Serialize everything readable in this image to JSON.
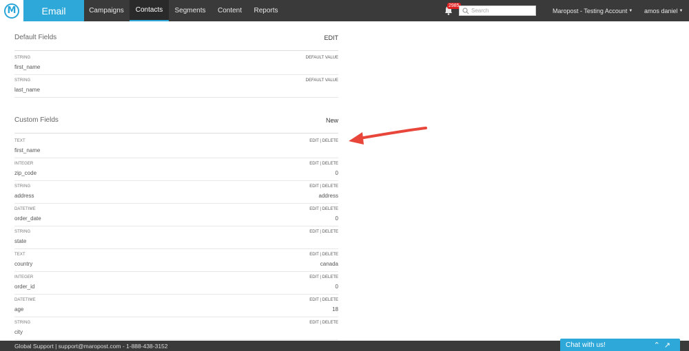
{
  "header": {
    "logo_letter": "M",
    "app_title": "Email",
    "nav": [
      {
        "label": "Campaigns"
      },
      {
        "label": "Contacts"
      },
      {
        "label": "Segments"
      },
      {
        "label": "Content"
      },
      {
        "label": "Reports"
      }
    ],
    "notification_count": "2985",
    "search_placeholder": "Search",
    "account": "Maropost - Testing Account",
    "user": "amos daniel"
  },
  "default_fields": {
    "title": "Default Fields",
    "action": "EDIT",
    "rows": [
      {
        "type": "STRING",
        "name": "first_name",
        "action": "DEFAULT VALUE",
        "value": ""
      },
      {
        "type": "STRING",
        "name": "last_name",
        "action": "DEFAULT VALUE",
        "value": ""
      }
    ]
  },
  "custom_fields": {
    "title": "Custom Fields",
    "action": "New",
    "rows": [
      {
        "type": "TEXT",
        "name": "first_name",
        "action": "EDIT | DELETE",
        "value": ""
      },
      {
        "type": "INTEGER",
        "name": "zip_code",
        "action": "EDIT | DELETE",
        "value": "0"
      },
      {
        "type": "STRING",
        "name": "address",
        "action": "EDIT | DELETE",
        "value": "address"
      },
      {
        "type": "DATETIME",
        "name": "order_date",
        "action": "EDIT | DELETE",
        "value": "0"
      },
      {
        "type": "STRING",
        "name": "state",
        "action": "EDIT | DELETE",
        "value": ""
      },
      {
        "type": "TEXT",
        "name": "country",
        "action": "EDIT | DELETE",
        "value": "canada"
      },
      {
        "type": "INTEGER",
        "name": "order_id",
        "action": "EDIT | DELETE",
        "value": "0"
      },
      {
        "type": "DATETIME",
        "name": "age",
        "action": "EDIT | DELETE",
        "value": "18"
      },
      {
        "type": "STRING",
        "name": "city",
        "action": "EDIT | DELETE",
        "value": ""
      }
    ]
  },
  "footer": {
    "text": "Global Support  |  support@maropost.com  -  1-888-438-3152"
  },
  "chat": {
    "label": "Chat with us!"
  },
  "colors": {
    "accent": "#2ea8d9",
    "topbar": "#3a3a3a",
    "arrow": "#e8463a"
  }
}
